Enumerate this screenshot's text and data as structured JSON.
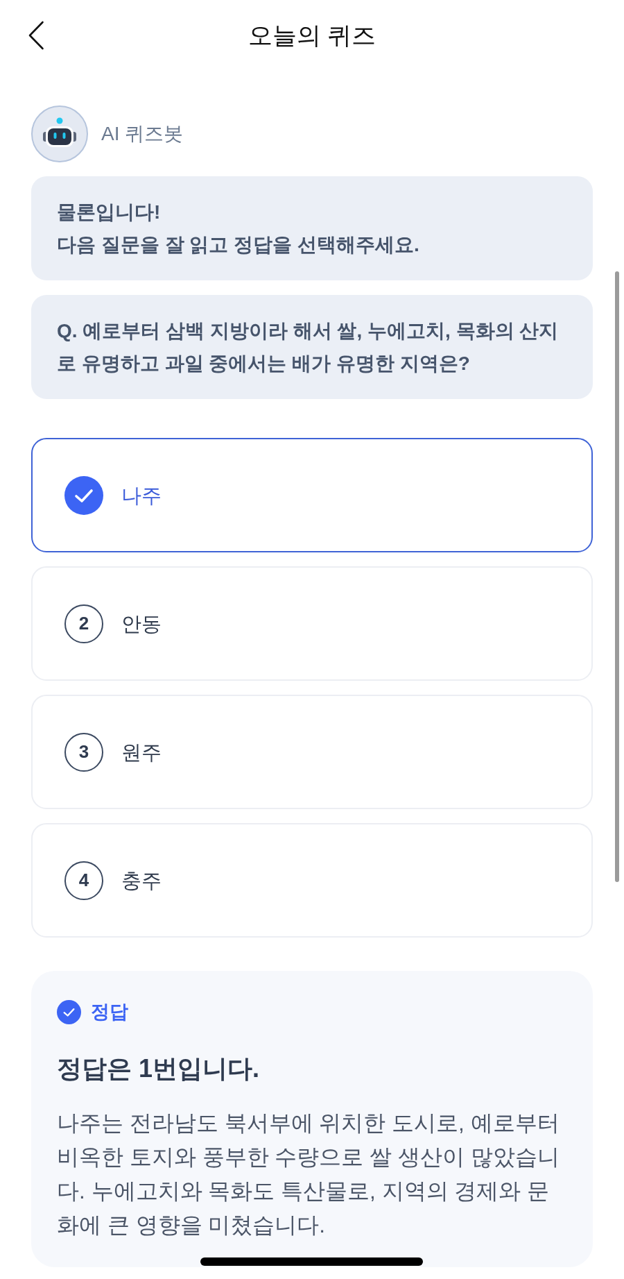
{
  "header": {
    "title": "오늘의 퀴즈"
  },
  "bot": {
    "name": "AI 퀴즈봇"
  },
  "messages": [
    "물론입니다!\n다음 질문을 잘 읽고 정답을 선택해주세요.",
    "Q. 예로부터 삼백 지방이라 해서 쌀, 누에고치, 목화의 산지로 유명하고 과일 중에서는 배가 유명한 지역은?"
  ],
  "options": [
    {
      "label": "나주",
      "selected": true
    },
    {
      "number": "2",
      "label": "안동",
      "selected": false
    },
    {
      "number": "3",
      "label": "원주",
      "selected": false
    },
    {
      "number": "4",
      "label": "충주",
      "selected": false
    }
  ],
  "answer": {
    "label": "정답",
    "title": "정답은 1번입니다.",
    "explanation": "나주는 전라남도 북서부에 위치한 도시로, 예로부터 비옥한 토지와 풍부한 수량으로 쌀 생산이 많았습니다. 누에고치와 목화도 특산물로, 지역의 경제와 문화에 큰 영향을 미쳤습니다."
  }
}
